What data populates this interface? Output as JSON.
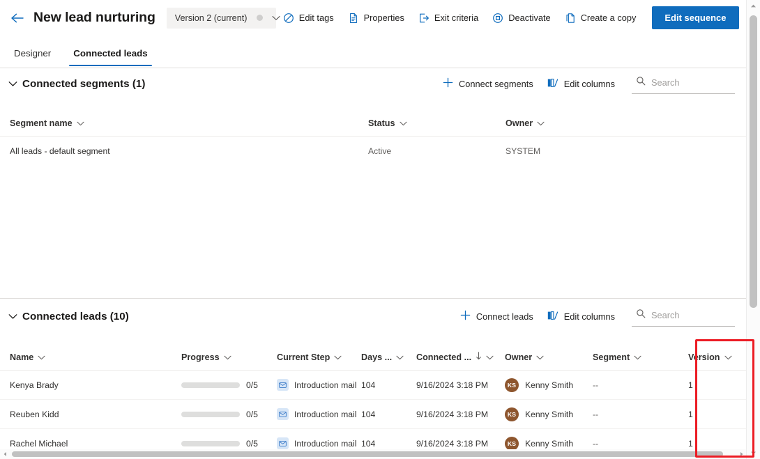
{
  "header": {
    "back_icon": "arrow-left-icon",
    "title": "New lead nurturing",
    "version_selector": {
      "label": "Version 2 (current)",
      "chevron_icon": "chevron-down-icon"
    },
    "commands": [
      {
        "label": "Edit tags",
        "icon": "tag-icon"
      },
      {
        "label": "Properties",
        "icon": "document-properties-icon"
      },
      {
        "label": "Exit criteria",
        "icon": "exit-icon"
      },
      {
        "label": "Deactivate",
        "icon": "circle-stop-icon"
      },
      {
        "label": "Create a copy",
        "icon": "copy-icon"
      }
    ],
    "primary_action": {
      "label": "Edit sequence",
      "color": "#0f6cbd"
    }
  },
  "tabs": [
    {
      "label": "Designer",
      "active": false
    },
    {
      "label": "Connected leads",
      "active": true
    }
  ],
  "segments_section": {
    "chevron_icon": "chevron-down-icon",
    "title": "Connected segments (1)",
    "actions": [
      {
        "label": "Connect segments",
        "icon": "plus-icon"
      },
      {
        "label": "Edit columns",
        "icon": "edit-columns-icon"
      }
    ],
    "search": {
      "placeholder": "Search",
      "value": "",
      "icon": "search-icon"
    },
    "columns": [
      {
        "label": "Segment name",
        "sort_icon": "chevron-down-icon"
      },
      {
        "label": "Status",
        "sort_icon": "chevron-down-icon"
      },
      {
        "label": "Owner",
        "sort_icon": "chevron-down-icon"
      }
    ],
    "rows": [
      {
        "segment_name": "All leads - default segment",
        "status": "Active",
        "owner": "SYSTEM"
      }
    ]
  },
  "leads_section": {
    "chevron_icon": "chevron-down-icon",
    "title": "Connected leads (10)",
    "actions": [
      {
        "label": "Connect leads",
        "icon": "plus-icon"
      },
      {
        "label": "Edit columns",
        "icon": "edit-columns-icon"
      }
    ],
    "search": {
      "placeholder": "Search",
      "value": "",
      "icon": "search-icon"
    },
    "columns": [
      {
        "label": "Name",
        "sort_icon": "chevron-down-icon",
        "sorted": false
      },
      {
        "label": "Progress",
        "sort_icon": "chevron-down-icon",
        "sorted": false
      },
      {
        "label": "Current Step",
        "sort_icon": "chevron-down-icon",
        "sorted": false
      },
      {
        "label": "Days ...",
        "sort_icon": "chevron-down-icon",
        "sorted": false
      },
      {
        "label": "Connected ...",
        "sort_icon": "chevron-down-icon",
        "sorted": true,
        "sort_direction_icon": "arrow-down-icon"
      },
      {
        "label": "Owner",
        "sort_icon": "chevron-down-icon",
        "sorted": false
      },
      {
        "label": "Segment",
        "sort_icon": "chevron-down-icon",
        "sorted": false
      },
      {
        "label": "Version",
        "sort_icon": "chevron-down-icon",
        "sorted": false
      }
    ],
    "rows": [
      {
        "name": "Kenya Brady",
        "progress_text": "0/5",
        "progress_pct": 0,
        "current_step": "Introduction mail",
        "current_step_icon": "mail-icon",
        "days": "104",
        "connected": "9/16/2024 3:18 PM",
        "owner": "Kenny Smith",
        "owner_initials": "KS",
        "segment": "--",
        "version": "1"
      },
      {
        "name": "Reuben Kidd",
        "progress_text": "0/5",
        "progress_pct": 0,
        "current_step": "Introduction mail",
        "current_step_icon": "mail-icon",
        "days": "104",
        "connected": "9/16/2024 3:18 PM",
        "owner": "Kenny Smith",
        "owner_initials": "KS",
        "segment": "--",
        "version": "1"
      },
      {
        "name": "Rachel Michael",
        "progress_text": "0/5",
        "progress_pct": 0,
        "current_step": "Introduction mail",
        "current_step_icon": "mail-icon",
        "days": "104",
        "connected": "9/16/2024 3:18 PM",
        "owner": "Kenny Smith",
        "owner_initials": "KS",
        "segment": "--",
        "version": "1"
      }
    ]
  },
  "annotation": {
    "highlight_color": "#ec1c24",
    "highlighted_column": "Version"
  },
  "colors": {
    "accent": "#0f6cbd",
    "avatar": "#8e562e",
    "mail_icon_bg": "#d7e6f7",
    "progress_track": "#dededd"
  }
}
